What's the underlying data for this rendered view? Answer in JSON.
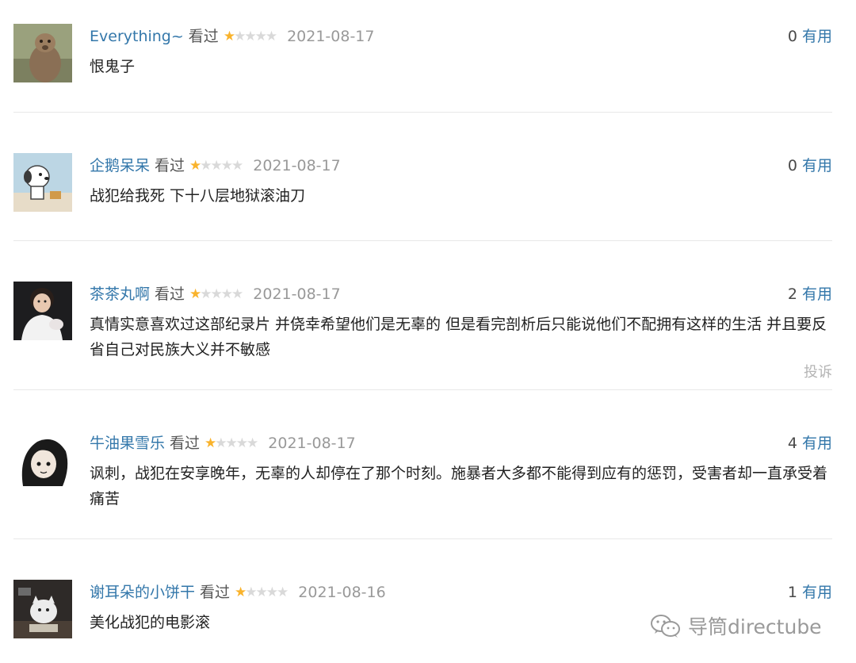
{
  "comments": [
    {
      "user": "Everything~",
      "status": "看过",
      "rating": 1,
      "date": "2021-08-17",
      "votes": "0",
      "useful_label": "有用",
      "text": "恨鬼子"
    },
    {
      "user": "企鹅呆呆",
      "status": "看过",
      "rating": 1,
      "date": "2021-08-17",
      "votes": "0",
      "useful_label": "有用",
      "text": "战犯给我死 下十八层地狱滚油刀"
    },
    {
      "user": "茶茶丸啊",
      "status": "看过",
      "rating": 1,
      "date": "2021-08-17",
      "votes": "2",
      "useful_label": "有用",
      "text": "真情实意喜欢过这部纪录片 并侥幸希望他们是无辜的 但是看完剖析后只能说他们不配拥有这样的生活 并且要反省自己对民族大义并不敏感",
      "report_label": "投诉"
    },
    {
      "user": "牛油果雪乐",
      "status": "看过",
      "rating": 1,
      "date": "2021-08-17",
      "votes": "4",
      "useful_label": "有用",
      "text": "讽刺，战犯在安享晚年，无辜的人却停在了那个时刻。施暴者大多都不能得到应有的惩罚，受害者却一直承受着痛苦"
    },
    {
      "user": "谢耳朵的小饼干",
      "status": "看过",
      "rating": 1,
      "date": "2021-08-16",
      "votes": "1",
      "useful_label": "有用",
      "text": "美化战犯的电影滚"
    }
  ],
  "rating_max": 5,
  "watermark": "导筒directube",
  "colors": {
    "link": "#3377aa",
    "star": "#f9b32c",
    "star_empty": "#d9d9d9",
    "divider": "#e8e8e8"
  },
  "icons": {
    "watermark": "wechat-icon"
  }
}
